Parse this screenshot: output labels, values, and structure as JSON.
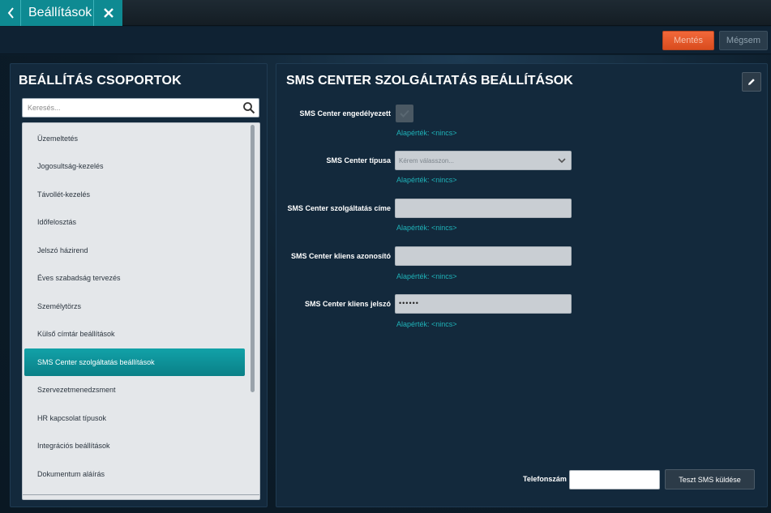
{
  "tab": {
    "title": "Beállítások",
    "back_icon": "chevron-left-icon",
    "close_icon": "close-icon"
  },
  "toolbar": {
    "save_label": "Mentés",
    "cancel_label": "Mégsem"
  },
  "left_panel": {
    "heading": "BEÁLLÍTÁS CSOPORTOK",
    "search_placeholder": "Keresés...",
    "items": [
      {
        "label": "Üzemeltetés"
      },
      {
        "label": "Jogosultság-kezelés"
      },
      {
        "label": "Távollét-kezelés"
      },
      {
        "label": "Időfelosztás"
      },
      {
        "label": "Jelszó házirend"
      },
      {
        "label": "Éves szabadság tervezés"
      },
      {
        "label": "Személytörzs"
      },
      {
        "label": "Külső címtár beállítások"
      },
      {
        "label": "SMS Center szolgáltatás beállítások"
      },
      {
        "label": "Szervezetmenedzsment"
      },
      {
        "label": "HR kapcsolat típusok"
      },
      {
        "label": "Integrációs beállítások"
      },
      {
        "label": "Dokumentum aláírás"
      }
    ],
    "active_item": "SMS Center szolgáltatás beállítások"
  },
  "right_panel": {
    "heading": "SMS CENTER SZOLGÁLTATÁS BEÁLLÍTÁSOK",
    "fields": {
      "enabled": {
        "label": "SMS Center engedélyezett",
        "default": "Alapérték: <nincs>"
      },
      "type": {
        "label": "SMS Center típusa",
        "placeholder": "Kérem válasszon...",
        "default": "Alapérték: <nincs>"
      },
      "address": {
        "label": "SMS Center szolgáltatás címe",
        "value": "",
        "default": "Alapérték: <nincs>"
      },
      "client_id": {
        "label": "SMS Center kliens azonosító",
        "value": "",
        "default": "Alapérték: <nincs>"
      },
      "password": {
        "label": "SMS Center kliens jelszó",
        "value": "••••••",
        "default": "Alapérték: <nincs>"
      }
    },
    "phone_label": "Telefonszám",
    "phone_value": "",
    "send_label": "Teszt SMS küldése"
  },
  "colors": {
    "accent": "#0e8a92",
    "save": "#e85a2c",
    "default_text": "#1fb2b8"
  }
}
